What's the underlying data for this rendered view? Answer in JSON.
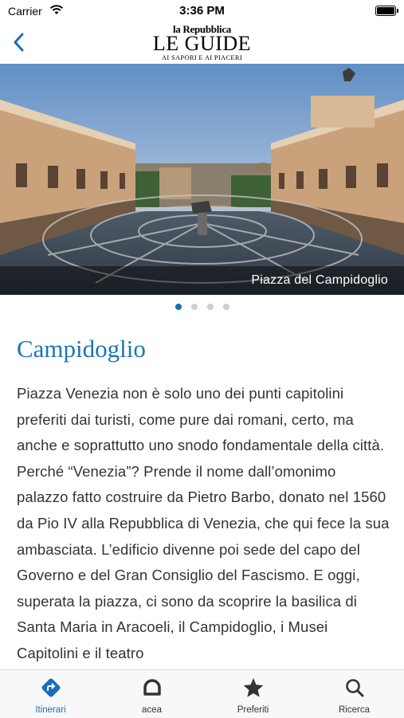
{
  "status_bar": {
    "carrier": "Carrier",
    "time": "3:36 PM"
  },
  "header": {
    "logo_line1": "la Repubblica",
    "logo_line2": "LE GUIDE",
    "logo_line3": "AI SAPORI E AI PIACERI"
  },
  "hero": {
    "caption": "Piazza del Campidoglio",
    "pages": 4,
    "current_page": 1
  },
  "article": {
    "title": "Campidoglio",
    "body": "Piazza Venezia non è solo uno dei punti capitolini preferiti dai turisti, come pure dai romani, certo, ma anche e soprattutto uno snodo fondamentale della città. Perché “Venezia”? Prende il nome dall’omonimo palazzo fatto costruire da Pietro Barbo, donato nel 1560 da Pio IV alla Repubblica di Venezia, che qui fece la sua ambasciata. L’edificio divenne poi sede del capo del Governo e del Gran Consiglio del Fascismo. E oggi, superata la piazza, ci sono da scoprire la basilica di Santa Maria in Aracoeli, il Campidoglio, i Musei Capitolini e il teatro"
  },
  "tabbar": {
    "tabs": [
      {
        "label": "Itinerari",
        "icon": "directions-icon",
        "active": true
      },
      {
        "label": "acea",
        "icon": "acea-logo-icon",
        "active": false
      },
      {
        "label": "Preferiti",
        "icon": "star-icon",
        "active": false
      },
      {
        "label": "Ricerca",
        "icon": "search-icon",
        "active": false
      }
    ]
  },
  "colors": {
    "accent": "#1a6fb5",
    "title": "#1a76b5"
  }
}
